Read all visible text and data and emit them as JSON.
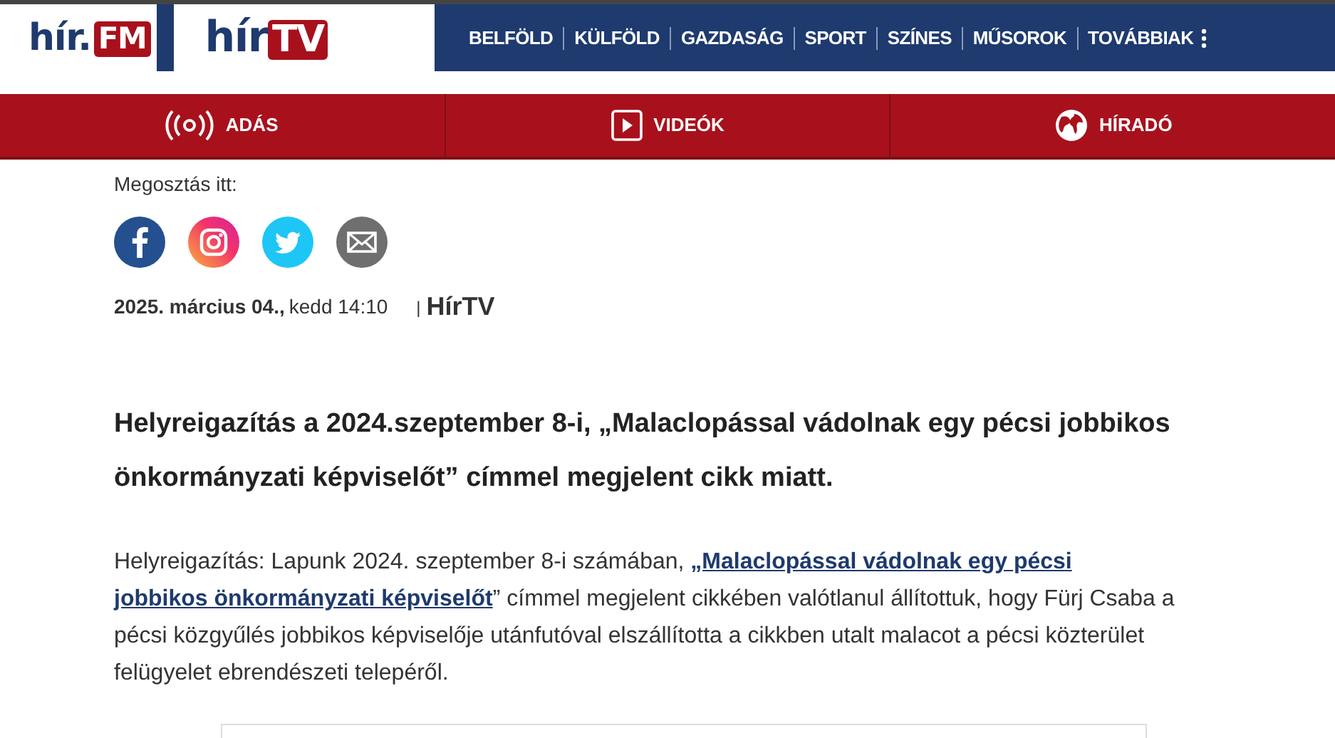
{
  "logos": [
    {
      "kind": "fm",
      "main": "hír.",
      "badge": "FM"
    },
    {
      "kind": "tv",
      "main": "hír",
      "badge": "TV"
    }
  ],
  "nav": [
    "BELFÖLD",
    "KÜLFÖLD",
    "GAZDASÁG",
    "SPORT",
    "SZÍNES",
    "MŰSOROK",
    "TOVÁBBIAK"
  ],
  "subnav": [
    {
      "kind": "live",
      "label": "ADÁS"
    },
    {
      "kind": "video",
      "label": "VIDEÓK"
    },
    {
      "kind": "news",
      "label": "HÍRADÓ"
    }
  ],
  "share": {
    "label": "Megosztás itt:",
    "icons": [
      {
        "kind": "facebook"
      },
      {
        "kind": "instagram"
      },
      {
        "kind": "twitter"
      },
      {
        "kind": "email"
      }
    ]
  },
  "meta": {
    "date": "2025. március 04.,",
    "time": "kedd 14:10",
    "separator": "|",
    "source": "HírTV"
  },
  "headline": "Helyreigazítás a 2024.szeptember 8-i, „Malaclopással vádolnak egy pécsi jobbikos önkormányzati képviselőt” címmel megjelent cikk miatt.",
  "body": {
    "before": "Helyreigazítás: Lapunk 2024. szeptember 8-i számában, ",
    "link": [
      "„Malaclopással vádolnak egy pécsi",
      "jobbikos önkormányzati képviselőt"
    ],
    "after": "” címmel megjelent cikkében valótlanul állítottuk, hogy Fürj Csaba a pécsi közgyűlés jobbikos képviselője utánfutóval elszállította a cikkben utalt malacot a pécsi közterület felügyelet ebrendészeti telepéről."
  }
}
